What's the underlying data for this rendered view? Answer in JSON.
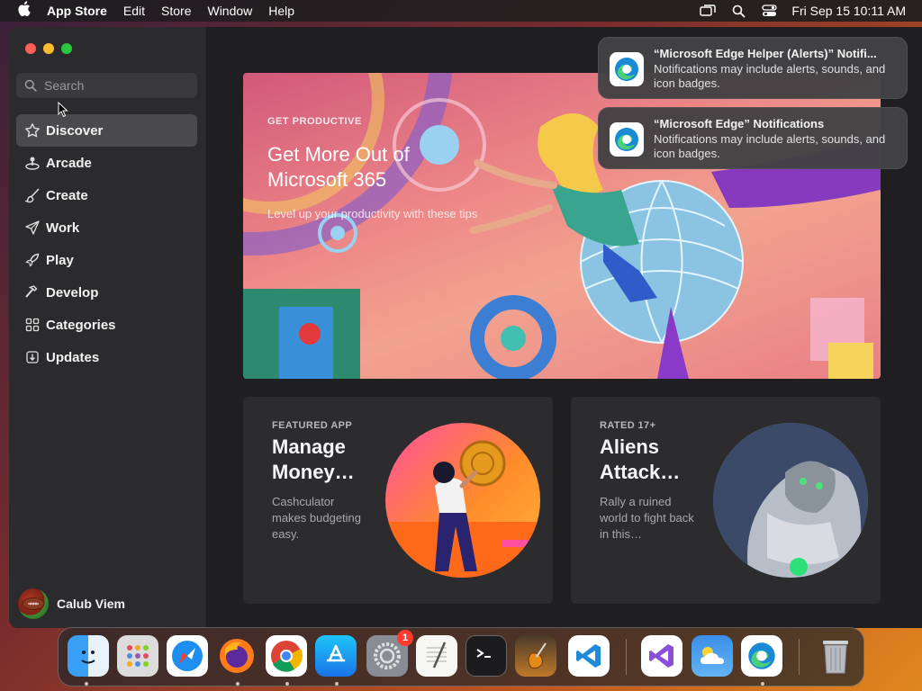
{
  "menubar": {
    "app": "App Store",
    "items": [
      "Edit",
      "Store",
      "Window",
      "Help"
    ],
    "clock": "Fri Sep 15  10:11 AM"
  },
  "sidebar": {
    "search_placeholder": "Search",
    "items": [
      {
        "label": "Discover",
        "icon": "star-icon",
        "active": true
      },
      {
        "label": "Arcade",
        "icon": "joystick-icon"
      },
      {
        "label": "Create",
        "icon": "brush-icon"
      },
      {
        "label": "Work",
        "icon": "paperplane-icon"
      },
      {
        "label": "Play",
        "icon": "rocket-icon"
      },
      {
        "label": "Develop",
        "icon": "hammer-icon"
      },
      {
        "label": "Categories",
        "icon": "grid-icon"
      },
      {
        "label": "Updates",
        "icon": "download-icon"
      }
    ],
    "user_name": "Calub Viem"
  },
  "hero": {
    "eyebrow": "GET PRODUCTIVE",
    "title": "Get More Out of Microsoft 365",
    "subtitle": "Level up your productivity with these tips"
  },
  "cards": [
    {
      "eyebrow": "FEATURED APP",
      "title": "Manage Money…",
      "description": "Cashculator makes budgeting easy."
    },
    {
      "eyebrow": "RATED 17+",
      "title": "Aliens Attack…",
      "description": "Rally a ruined world to fight back in this…"
    }
  ],
  "notifications": [
    {
      "title": "“Microsoft Edge Helper (Alerts)” Notifi...",
      "body": "Notifications may include alerts, sounds, and icon badges."
    },
    {
      "title": "“Microsoft Edge” Notifications",
      "body": "Notifications may include alerts, sounds, and icon badges."
    }
  ],
  "dock": {
    "settings_badge": "1",
    "apps": [
      "finder-icon",
      "launchpad-icon",
      "safari-icon",
      "firefox-icon",
      "chrome-icon",
      "appstore-icon",
      "system-settings-icon",
      "textedit-icon",
      "terminal-icon",
      "garageband-icon",
      "vscode-icon",
      "visual-studio-icon",
      "weather-icon",
      "edge-icon",
      "trash-icon"
    ]
  },
  "colors": {
    "accent": "#0a84ff",
    "sidebar_active": "#4a4a4c",
    "badge": "#ff3b30"
  }
}
